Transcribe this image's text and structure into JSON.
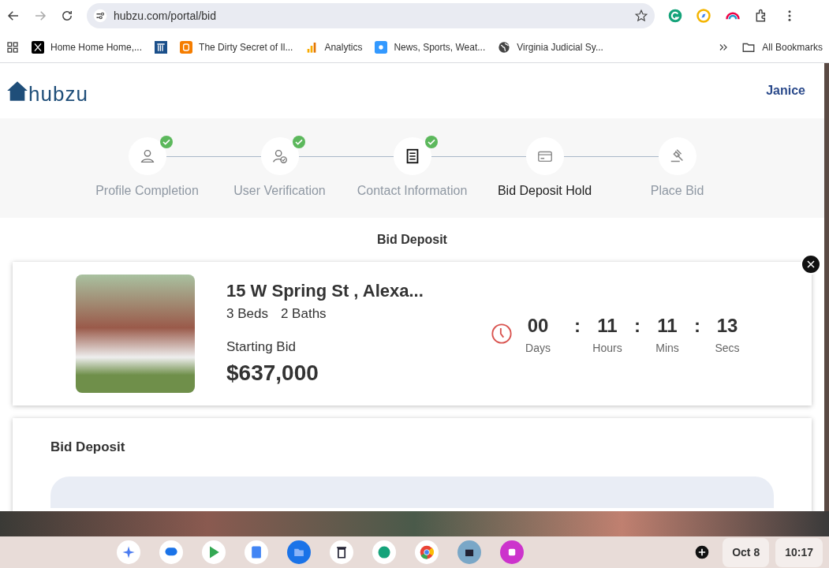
{
  "browser": {
    "url": "hubzu.com/portal/bid",
    "bookmarks": [
      "Home Home Home,...",
      "The Dirty Secret of Il...",
      "Analytics",
      "News, Sports, Weat...",
      "Virginia Judicial Sy..."
    ],
    "all_bookmarks": "All Bookmarks"
  },
  "header": {
    "logo": "hubzu",
    "user": "Janice"
  },
  "steps": [
    {
      "label": "Profile Completion",
      "done": true,
      "selected": false
    },
    {
      "label": "User Verification",
      "done": true,
      "selected": false
    },
    {
      "label": "Contact Information",
      "done": true,
      "selected": false
    },
    {
      "label": "Bid Deposit Hold",
      "done": false,
      "selected": true
    },
    {
      "label": "Place Bid",
      "done": false,
      "selected": false
    }
  ],
  "section_title": "Bid Deposit",
  "property": {
    "address": "15 W Spring St , Alexa...",
    "beds": "3 Beds",
    "baths": "2 Baths",
    "bid_label": "Starting Bid",
    "bid": "$637,000"
  },
  "countdown": [
    {
      "value": "00",
      "unit": "Days"
    },
    {
      "value": "11",
      "unit": "Hours",
      "separator": ":"
    },
    {
      "value": "11",
      "unit": "Mins",
      "separator": ":"
    },
    {
      "value": "13",
      "unit": "Secs",
      "separator": ":"
    }
  ],
  "deposit_card": {
    "title": "Bid Deposit"
  },
  "shelf": {
    "date": "Oct 8",
    "time": "10:17"
  }
}
